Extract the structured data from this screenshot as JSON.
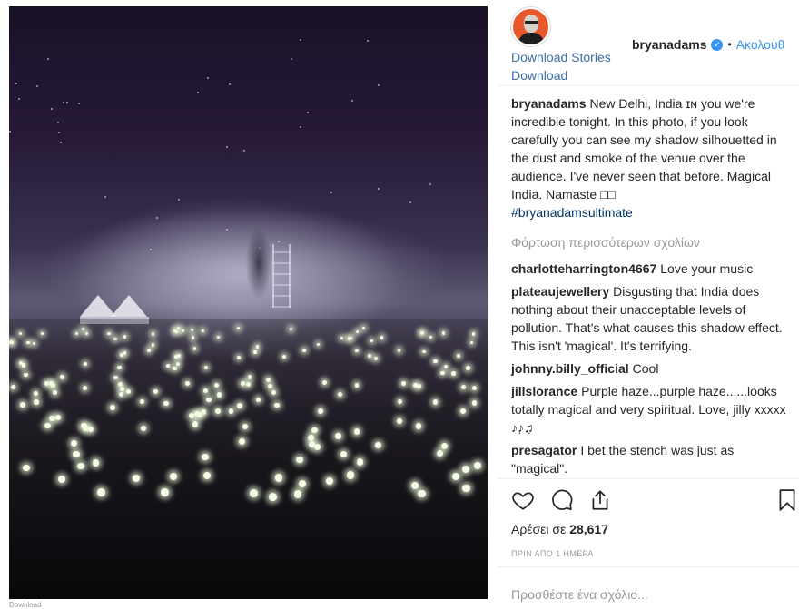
{
  "post": {
    "photo_caption_below": "Download",
    "header": {
      "username": "bryanadams",
      "verified_glyph": "✓",
      "separator": "•",
      "follow_label": "Ακολουθ",
      "download_links": [
        "Download Stories",
        "Download"
      ]
    },
    "caption": {
      "username": "bryanadams",
      "text": "New Delhi, India ɪɴ you we're incredible tonight. In this photo, if you look carefully you can see my shadow silhouetted in the dust and smoke of the venue over the audience. I've never seen that before. Magical India. Namaste □□",
      "hashtag": "#bryanadamsultimate"
    },
    "load_more_label": "Φόρτωση περισσότερων σχολίων",
    "comments": [
      {
        "username": "charlotteharrington4667",
        "text": "Love your music"
      },
      {
        "username": "plateaujewellery",
        "text": "Disgusting that India does nothing about their unacceptable levels of pollution. That's what causes this shadow effect. This isn't 'magical'. It's terrifying."
      },
      {
        "username": "johnny.billy_official",
        "text": "Cool"
      },
      {
        "username": "jillslorance",
        "text": "Purple haze...purple haze......looks totally magical and very spiritual. Love, jilly xxxxx ♪♪̣♫̣"
      },
      {
        "username": "presagator",
        "text": "I bet the stench was just as \"magical\"."
      }
    ],
    "likes": {
      "label": "Αρέσει σε",
      "count": "28,617"
    },
    "timestamp": "ΠΡΙΝ ΑΠΟ 1 ΗΜΕΡΑ",
    "add_comment_placeholder": "Προσθέστε ένα σχόλιο...",
    "icons": [
      "heart-icon",
      "comment-icon",
      "share-icon",
      "bookmark-icon"
    ],
    "colors": {
      "link": "#3897f0",
      "hashtag": "#003569",
      "muted": "#999999",
      "text": "#262626"
    }
  }
}
